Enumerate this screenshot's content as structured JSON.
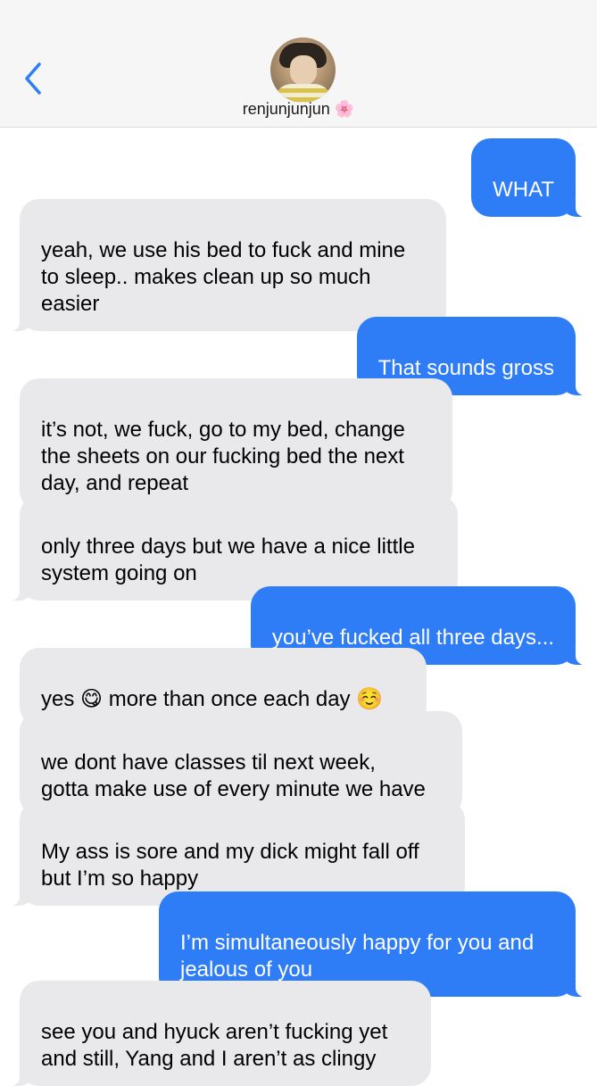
{
  "header": {
    "contact_name": "renjunjunjun",
    "contact_emoji": "🌸",
    "back_icon": "chevron-left-icon"
  },
  "colors": {
    "outgoing_bubble": "#2f7df6",
    "incoming_bubble": "#e9e9eb",
    "accent": "#2f7df6"
  },
  "messages": [
    {
      "direction": "outgoing",
      "text": "WHAT"
    },
    {
      "direction": "incoming",
      "text": "yeah, we use his bed to fuck and mine\nto sleep.. makes clean up so much\neasier"
    },
    {
      "direction": "outgoing",
      "text": "That sounds gross"
    },
    {
      "direction": "incoming",
      "text": "it’s not, we fuck, go to my bed, change\nthe sheets on our fucking bed the next\nday, and repeat"
    },
    {
      "direction": "incoming",
      "text": "only three days but we have a nice little\nsystem going on"
    },
    {
      "direction": "outgoing",
      "text": "you’ve fucked all three days..."
    },
    {
      "direction": "incoming",
      "text": "yes 😋 more than once each day ☺️"
    },
    {
      "direction": "incoming",
      "text": "we dont have classes til next week,\ngotta make use of every minute we have"
    },
    {
      "direction": "incoming",
      "text": "My ass is sore and my dick might fall off\nbut I’m so happy"
    },
    {
      "direction": "outgoing",
      "text": "I’m simultaneously happy for you and\njealous of you"
    },
    {
      "direction": "incoming",
      "text": "see you and hyuck aren’t fucking yet\nand still, Yang and I aren’t as clingy"
    }
  ]
}
